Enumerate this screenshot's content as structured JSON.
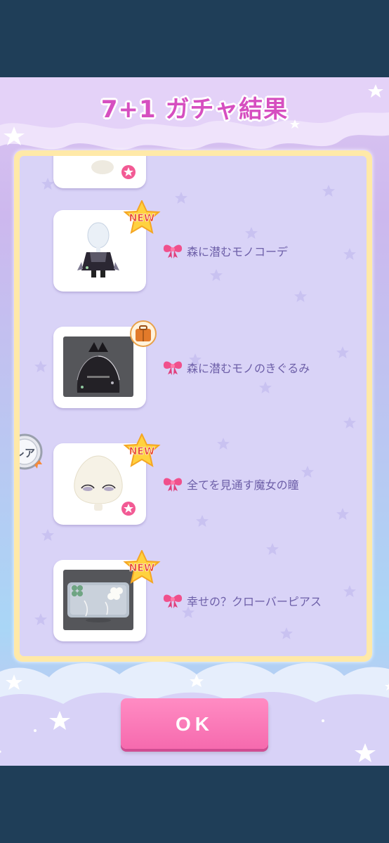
{
  "header": {
    "title": "7+1 ガチャ結果"
  },
  "items": [
    {
      "name": "森に潜むモノコーデ",
      "badge": "NEW",
      "rarity": "",
      "type": "outfit"
    },
    {
      "name": "森に潜むモノのきぐるみ",
      "badge": "bag",
      "rarity": "",
      "type": "costume"
    },
    {
      "name": "全てを見通す魔女の瞳",
      "badge": "NEW",
      "rarity": "レア",
      "type": "eyes"
    },
    {
      "name": "幸せの？クローバーピアス",
      "badge": "NEW",
      "rarity": "",
      "type": "earrings"
    }
  ],
  "badges": {
    "new_label": "NEW"
  },
  "footer": {
    "ok_label": "OK"
  },
  "colors": {
    "title": "#d64fc0",
    "panel_bg": "#d9d3f7",
    "panel_border": "#ffe9a8",
    "item_text": "#6d5fa8",
    "ok_button": "#f66aae",
    "system_bar": "#1f3e58"
  }
}
